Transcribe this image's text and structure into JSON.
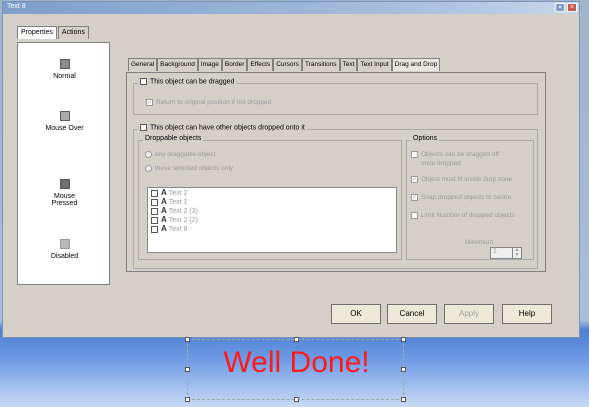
{
  "window": {
    "title": "Text 8",
    "minimize_glyph": "▪",
    "close_glyph": "×"
  },
  "outer_tabs": [
    {
      "label": "Properties",
      "active": true
    },
    {
      "label": "Actions",
      "active": false
    }
  ],
  "states": [
    {
      "label": "Normal",
      "icon": "button-normal-icon"
    },
    {
      "label": "Mouse Over",
      "icon": "cursor-pointer-icon"
    },
    {
      "label": "Mouse Pressed",
      "icon": "button-pressed-icon"
    },
    {
      "label": "Disabled",
      "icon": "button-disabled-icon"
    }
  ],
  "inner_tabs": [
    {
      "label": "General"
    },
    {
      "label": "Background"
    },
    {
      "label": "Image"
    },
    {
      "label": "Border"
    },
    {
      "label": "Effects"
    },
    {
      "label": "Cursors"
    },
    {
      "label": "Transitions"
    },
    {
      "label": "Text"
    },
    {
      "label": "Text Input"
    },
    {
      "label": "Drag and Drop",
      "active": true
    }
  ],
  "drag": {
    "can_drag_label": "This object can be dragged",
    "return_label": "Return to original position if not dropped",
    "return_glyph": "✓"
  },
  "drop": {
    "can_drop_label": "This object can have other objects dropped onto it",
    "droppable_title": "Droppable objects",
    "radio_any": "any draggable object",
    "radio_selected": "these selected objects only",
    "list_items": [
      "Text 2",
      "Text 1",
      "Text 2 (3)",
      "Text 2 (2)",
      "Text 8"
    ],
    "list_icon_glyph": "A"
  },
  "options": {
    "title": "Options",
    "opt1_line1": "Objects can be dragged off",
    "opt1_line2": "once dropped",
    "opt2": "Object must fit inside drop zone",
    "opt3": "Snap dropped objects to centre",
    "opt4": "Limit Number of dropped objects",
    "maximum_label": "Maximum",
    "maximum_value": "1",
    "check_glyph": "✓",
    "stepper_up": "▲",
    "stepper_down": "▼"
  },
  "buttons": {
    "ok": "OK",
    "cancel": "Cancel",
    "apply": "Apply",
    "help": "Help"
  },
  "canvas": {
    "text": "Well Done!",
    "color": "#ff1a1a"
  }
}
